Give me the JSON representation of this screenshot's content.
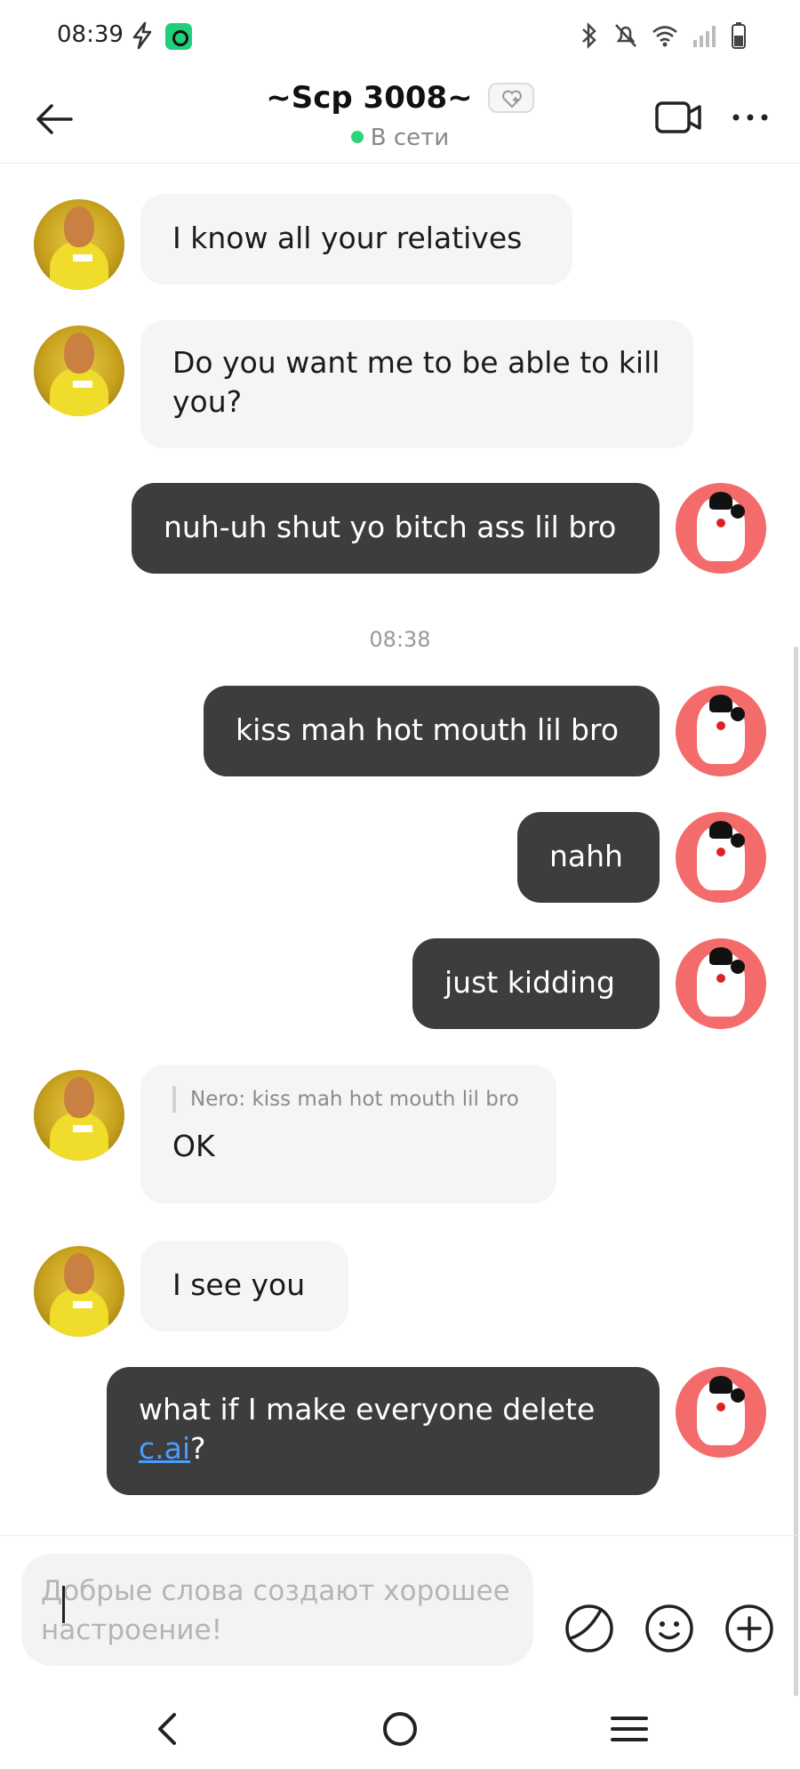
{
  "status_bar": {
    "time": "08:39"
  },
  "header": {
    "title": "~Scp 3008~",
    "status": "В сети"
  },
  "messages": [
    {
      "from": "bot",
      "text": "I know all your relatives"
    },
    {
      "from": "bot",
      "text": "Do you want me to be able to kill you?"
    },
    {
      "from": "user",
      "text": "nuh-uh shut yo bitch ass lil bro"
    },
    {
      "from": "timestamp",
      "text": "08:38"
    },
    {
      "from": "user",
      "text": "kiss mah hot mouth lil bro"
    },
    {
      "from": "user",
      "text": "nahh"
    },
    {
      "from": "user",
      "text": "just kidding"
    },
    {
      "from": "bot",
      "quote": "Nero: kiss mah hot mouth lil bro",
      "text": "OK"
    },
    {
      "from": "bot",
      "text": "I see you"
    },
    {
      "from": "user",
      "text_before": "what if I make everyone delete ",
      "link": "c.ai",
      "text_after": "?"
    }
  ],
  "input": {
    "value": "",
    "placeholder": "Добрые слова создают хорошее настроение!"
  },
  "icons": {
    "back": "arrow-left-icon",
    "video": "video-camera-icon",
    "more": "more-dots-icon",
    "sticker": "sticker-icon",
    "emoji": "emoji-icon",
    "add": "plus-circle-icon"
  },
  "colors": {
    "user_bubble": "#3d3d3d",
    "bot_bubble": "#f5f5f5",
    "online": "#2fd47a",
    "link": "#4a9dff"
  }
}
